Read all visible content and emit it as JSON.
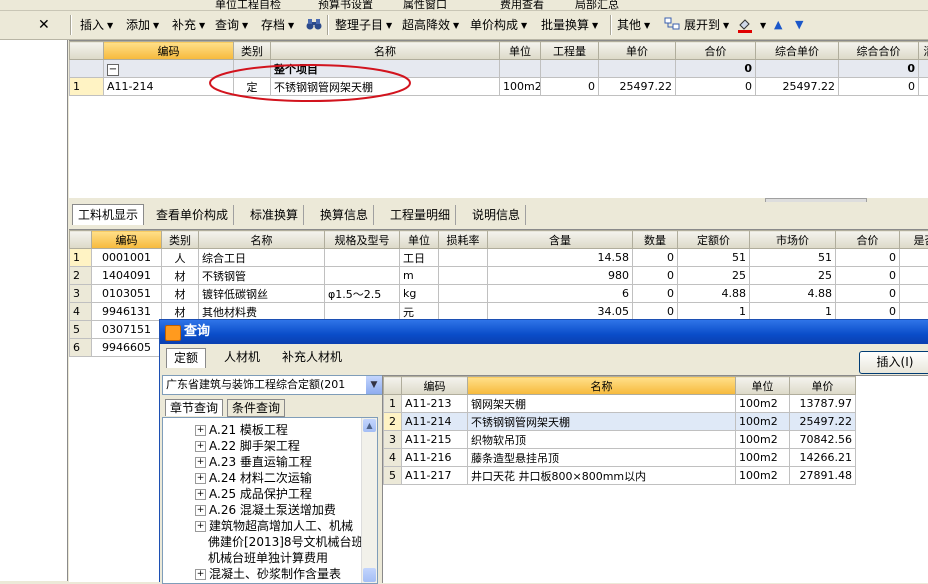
{
  "top_toolbar": {
    "items": [
      "单位工程自检",
      "预算书设置",
      "属性窗口",
      "费用查看",
      "局部汇总"
    ]
  },
  "toolbar": {
    "close": "✕",
    "items": [
      "插入",
      "添加",
      "补充",
      "查询",
      "存档",
      "整理子目",
      "超高降效",
      "单价构成",
      "批量换算",
      "其他",
      "展开到"
    ]
  },
  "top_grid": {
    "headers": [
      "编码",
      "类别",
      "名称",
      "单位",
      "工程量",
      "单价",
      "合价",
      "综合单价",
      "综合合价",
      "清"
    ],
    "group_row": {
      "toggle": "−",
      "name": "整个项目",
      "amount": "0",
      "total": "0"
    },
    "rows": [
      {
        "idx": "1",
        "code": "A11-214",
        "type": "定",
        "name": "不锈钢钢管网架天棚",
        "unit": "100m2",
        "qty": "0",
        "price": "25497.22",
        "amount": "0",
        "unit_price": "25497.22",
        "total": "0"
      }
    ]
  },
  "tabs": [
    "工料机显示",
    "查看单价构成",
    "标准换算",
    "换算信息",
    "工程量明细",
    "说明信息"
  ],
  "bottom_grid": {
    "headers": [
      "编码",
      "类别",
      "名称",
      "规格及型号",
      "单位",
      "损耗率",
      "含量",
      "数量",
      "定额价",
      "市场价",
      "合价",
      "是否"
    ],
    "rows": [
      {
        "idx": "1",
        "code": "0001001",
        "type": "人",
        "name": "综合工日",
        "spec": "",
        "unit": "工日",
        "loss": "",
        "content": "14.58",
        "count": "0",
        "base": "51",
        "market": "51",
        "amount": "0"
      },
      {
        "idx": "2",
        "code": "1404091",
        "type": "材",
        "name": "不锈钢管",
        "spec": "",
        "unit": "m",
        "loss": "",
        "content": "980",
        "count": "0",
        "base": "25",
        "market": "25",
        "amount": "0"
      },
      {
        "idx": "3",
        "code": "0103051",
        "type": "材",
        "name": "镀锌低碳钢丝",
        "spec": "φ1.5～2.5",
        "unit": "kg",
        "loss": "",
        "content": "6",
        "count": "0",
        "base": "4.88",
        "market": "4.88",
        "amount": "0"
      },
      {
        "idx": "4",
        "code": "9946131",
        "type": "材",
        "name": "其他材料费",
        "spec": "",
        "unit": "元",
        "loss": "",
        "content": "34.05",
        "count": "0",
        "base": "1",
        "market": "1",
        "amount": "0"
      },
      {
        "idx": "5",
        "code": "0307151",
        "type": "",
        "name": "",
        "spec": "",
        "unit": "",
        "loss": "",
        "content": "",
        "count": "",
        "base": "",
        "market": "",
        "amount": ""
      },
      {
        "idx": "6",
        "code": "9946605",
        "type": "",
        "name": "",
        "spec": "",
        "unit": "",
        "loss": "",
        "content": "",
        "count": "",
        "base": "",
        "market": "",
        "amount": ""
      }
    ]
  },
  "dialog": {
    "title": "查询",
    "tabs": [
      "定额",
      "人材机",
      "补充人材机"
    ],
    "insert_button": "插入(I)",
    "quota_select": "广东省建筑与装饰工程综合定额(201",
    "subtabs": [
      "章节查询",
      "条件查询"
    ],
    "tree": [
      {
        "label": "A.21 模板工程",
        "expander": "+"
      },
      {
        "label": "A.22 脚手架工程",
        "expander": "+"
      },
      {
        "label": "A.23 垂直运输工程",
        "expander": "+"
      },
      {
        "label": "A.24 材料二次运输",
        "expander": "+"
      },
      {
        "label": "A.25 成品保护工程",
        "expander": "+"
      },
      {
        "label": "A.26 混凝土泵送增加费",
        "expander": "+"
      },
      {
        "label": "建筑物超高增加人工、机械",
        "expander": "+"
      },
      {
        "label": "佛建价[2013]8号文机械台班",
        "expander": ""
      },
      {
        "label": "机械台班单独计算费用",
        "expander": ""
      },
      {
        "label": "混凝土、砂浆制作含量表",
        "expander": "+"
      }
    ],
    "result_grid": {
      "headers": [
        "编码",
        "名称",
        "单位",
        "单价"
      ],
      "rows": [
        {
          "idx": "1",
          "code": "A11-213",
          "name": "钢网架天棚",
          "unit": "100m2",
          "price": "13787.97"
        },
        {
          "idx": "2",
          "code": "A11-214",
          "name": "不锈钢钢管网架天棚",
          "unit": "100m2",
          "price": "25497.22"
        },
        {
          "idx": "3",
          "code": "A11-215",
          "name": "织物软吊顶",
          "unit": "100m2",
          "price": "70842.56"
        },
        {
          "idx": "4",
          "code": "A11-216",
          "name": "藤条造型悬挂吊顶",
          "unit": "100m2",
          "price": "14266.21"
        },
        {
          "idx": "5",
          "code": "A11-217",
          "name": "井口天花 井口板800×800mm以内",
          "unit": "100m2",
          "price": "27891.48"
        }
      ]
    }
  },
  "colors": {
    "header_selected": "#f6b93b",
    "annotation": "#d2141e",
    "title_bar": "#0a4dc9"
  },
  "icons": [
    "close-icon",
    "search-binoculars-icon",
    "expand-icon",
    "fill-color-icon",
    "move-up-icon",
    "move-down-icon",
    "dialog-app-icon",
    "dropdown-arrow-icon",
    "tree-expand-icon"
  ]
}
